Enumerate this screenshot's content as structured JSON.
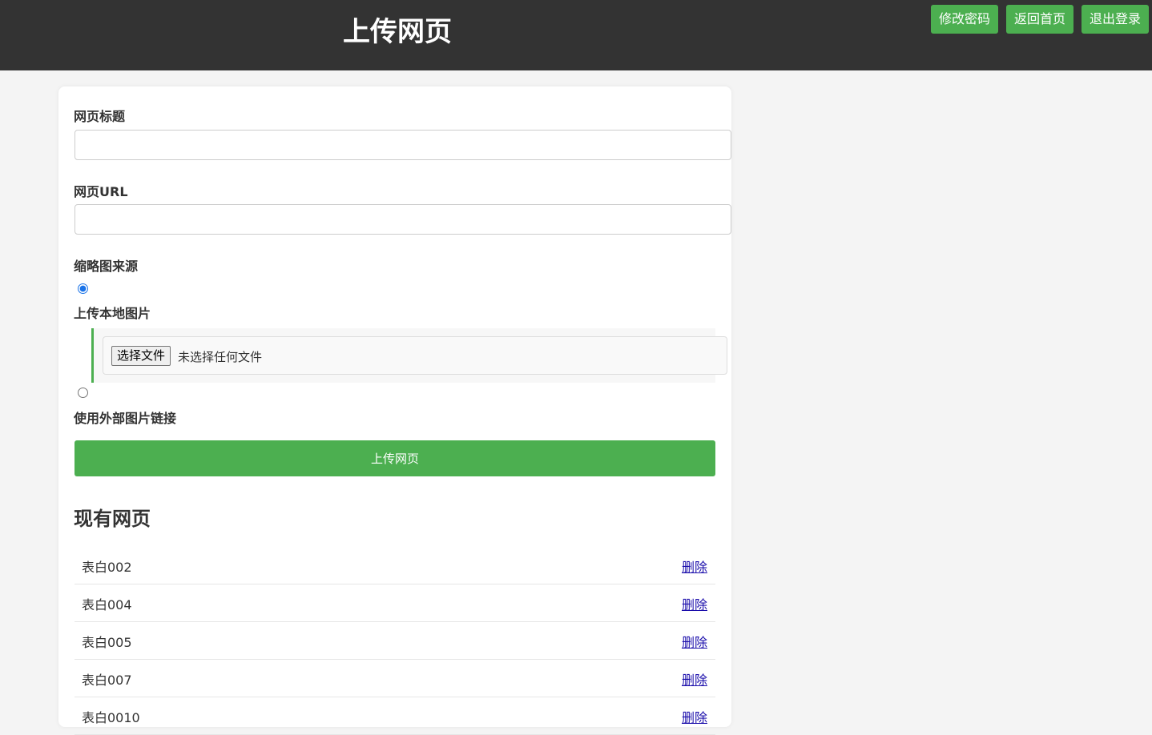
{
  "header": {
    "title": "上传网页",
    "buttons": {
      "change_password": "修改密码",
      "back_home": "返回首页",
      "logout": "退出登录"
    }
  },
  "form": {
    "title_label": "网页标题",
    "title_value": "",
    "url_label": "网页URL",
    "url_value": "",
    "thumb_label": "缩略图来源",
    "option_local": "上传本地图片",
    "option_external": "使用外部图片链接",
    "selected_option": "local",
    "file_button": "选择文件",
    "file_status": "未选择任何文件",
    "submit": "上传网页"
  },
  "existing": {
    "title": "现有网页",
    "delete_label": "删除",
    "items": [
      {
        "name": "表白002"
      },
      {
        "name": "表白004"
      },
      {
        "name": "表白005"
      },
      {
        "name": "表白007"
      },
      {
        "name": "表白0010"
      }
    ]
  },
  "colors": {
    "accent": "#4caf50",
    "header_bg": "#333333",
    "link": "#1a0dab"
  }
}
